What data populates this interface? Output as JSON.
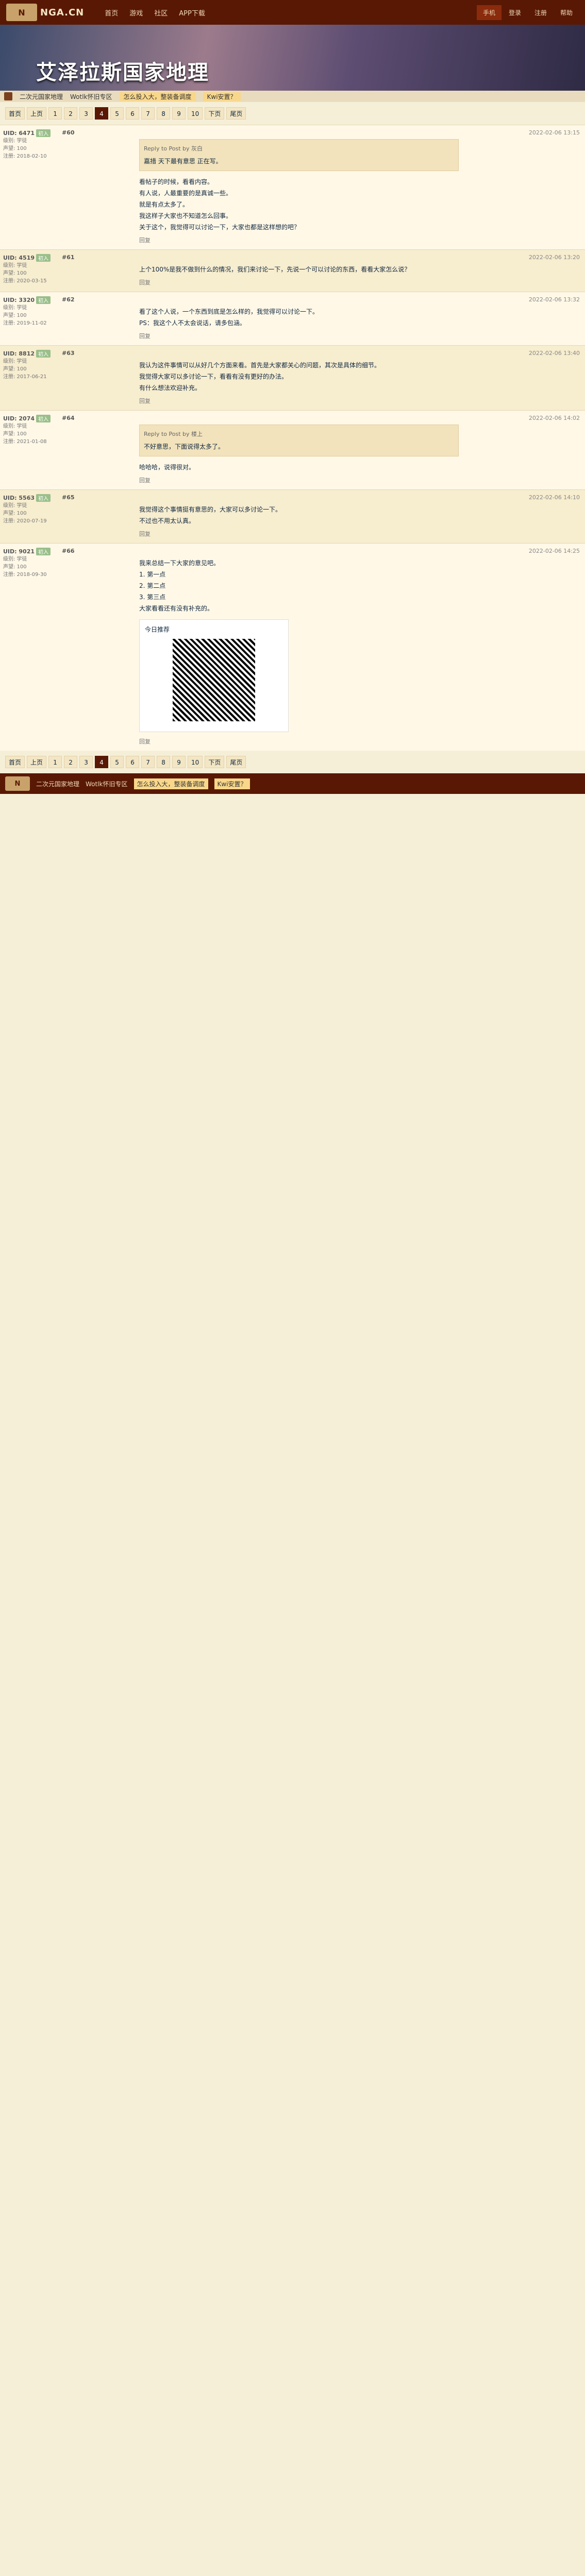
{
  "site": {
    "logo": "NGA.CN",
    "nav": [
      "首页",
      "游戏",
      "社区",
      "APP下载"
    ],
    "user_nav": [
      "手机",
      "登录",
      "注册",
      "帮助"
    ]
  },
  "banner": {
    "title": "艾泽拉斯国家地理",
    "strip": [
      "二次元国家地理",
      "Wotlk怀旧专区",
      "怎么投入大，整装备调度",
      "Kwi安置？"
    ]
  },
  "pager": {
    "items": [
      "首页",
      "上页",
      "1",
      "2",
      "3",
      "4",
      "5",
      "6",
      "7",
      "8",
      "9",
      "10",
      "下页",
      "尾页"
    ],
    "current": "4"
  },
  "posts": [
    {
      "uid": "UID: 6471",
      "tag": "初入",
      "meta": [
        "级别: 学徒",
        "声望: 100",
        "注册: 2018-02-10"
      ],
      "floor": "#60",
      "time": "2022-02-06 13:15",
      "reply_to": "Reply to Post by 灰白",
      "quote": "嘉措 天下最有意思 正在写。",
      "content": "看帖子的时候，看看内容。\n有人说，人最重要的是真诚一些。\n就是有点太多了。\n我这样子大家也不知道怎么回事。\n关于这个，我觉得可以讨论一下，大家也都是这样想的吧？",
      "footer": "回复"
    },
    {
      "uid": "UID: 4519",
      "tag": "初入",
      "meta": [
        "级别: 学徒",
        "声望: 100",
        "注册: 2020-03-15"
      ],
      "floor": "#61",
      "time": "2022-02-06 13:20",
      "content": "上个100%是我不做到什么的情况，我们来讨论一下，先说一个可以讨论的东西，看看大家怎么说？",
      "footer": "回复"
    },
    {
      "uid": "UID: 3320",
      "tag": "初入",
      "meta": [
        "级别: 学徒",
        "声望: 100",
        "注册: 2019-11-02"
      ],
      "floor": "#62",
      "time": "2022-02-06 13:32",
      "content": "看了这个人说，一个东西到底是怎么样的，我觉得可以讨论一下。\nPS：我这个人不太会说话，请多包涵。",
      "footer": "回复"
    },
    {
      "uid": "UID: 8812",
      "tag": "初入",
      "meta": [
        "级别: 学徒",
        "声望: 100",
        "注册: 2017-06-21"
      ],
      "floor": "#63",
      "time": "2022-02-06 13:40",
      "content": "我认为这件事情可以从好几个方面来看。首先是大家都关心的问题，其次是具体的细节。\n我觉得大家可以多讨论一下，看看有没有更好的办法。\n有什么想法欢迎补充。",
      "footer": "回复"
    },
    {
      "uid": "UID: 2074",
      "tag": "初入",
      "meta": [
        "级别: 学徒",
        "声望: 100",
        "注册: 2021-01-08"
      ],
      "floor": "#64",
      "time": "2022-02-06 14:02",
      "reply_to": "Reply to Post by 楼上",
      "quote": "不好意思，下面说得太多了。",
      "content": "哈哈哈，说得很对。",
      "footer": "回复"
    },
    {
      "uid": "UID: 5563",
      "tag": "初入",
      "meta": [
        "级别: 学徒",
        "声望: 100",
        "注册: 2020-07-19"
      ],
      "floor": "#65",
      "time": "2022-02-06 14:10",
      "content": "我觉得这个事情挺有意思的，大家可以多讨论一下。\n不过也不用太认真。",
      "footer": "回复"
    },
    {
      "uid": "UID: 9021",
      "tag": "初入",
      "meta": [
        "级别: 学徒",
        "声望: 100",
        "注册: 2018-09-30"
      ],
      "floor": "#66",
      "time": "2022-02-06 14:25",
      "content": "我来总结一下大家的意见吧。\n1. 第一点\n2. 第二点\n3. 第三点\n大家看看还有没有补充的。",
      "card_title": "今日推荐",
      "footer": "回复"
    }
  ],
  "footer_strip": [
    "二次元国家地理",
    "Wotlk怀旧专区",
    "怎么投入大，整装备调度",
    "Kwi安置？"
  ]
}
